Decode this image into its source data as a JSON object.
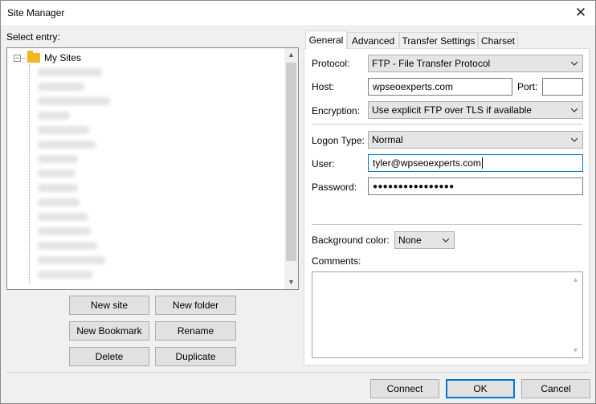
{
  "window": {
    "title": "Site Manager",
    "close_glyph": "✕"
  },
  "left": {
    "select_entry_label": "Select entry:",
    "tree_root": {
      "expander": "−",
      "label": "My Sites"
    }
  },
  "buttons": {
    "new_site": "New site",
    "new_folder": "New folder",
    "new_bookmark": "New Bookmark",
    "rename": "Rename",
    "delete": "Delete",
    "duplicate": "Duplicate",
    "connect": "Connect",
    "ok": "OK",
    "cancel": "Cancel"
  },
  "tabs": [
    {
      "label": "General",
      "active": true
    },
    {
      "label": "Advanced"
    },
    {
      "label": "Transfer Settings"
    },
    {
      "label": "Charset"
    }
  ],
  "general": {
    "protocol_label": "Protocol:",
    "protocol_value": "FTP - File Transfer Protocol",
    "host_label": "Host:",
    "host_value": "wpseoexperts.com",
    "port_label": "Port:",
    "port_value": "",
    "encryption_label": "Encryption:",
    "encryption_value": "Use explicit FTP over TLS if available",
    "logon_type_label": "Logon Type:",
    "logon_type_value": "Normal",
    "user_label": "User:",
    "user_value": "tyler@wpseoexperts.com",
    "password_label": "Password:",
    "password_mask": "●●●●●●●●●●●●●●●●",
    "background_color_label": "Background color:",
    "background_color_value": "None",
    "comments_label": "Comments:",
    "comments_value": ""
  },
  "colors": {
    "accent": "#0078d7",
    "folder": "#f4b722"
  },
  "icons": {
    "close": "close-icon",
    "folder": "folder-icon",
    "dropdown": "chevron-down-icon"
  }
}
